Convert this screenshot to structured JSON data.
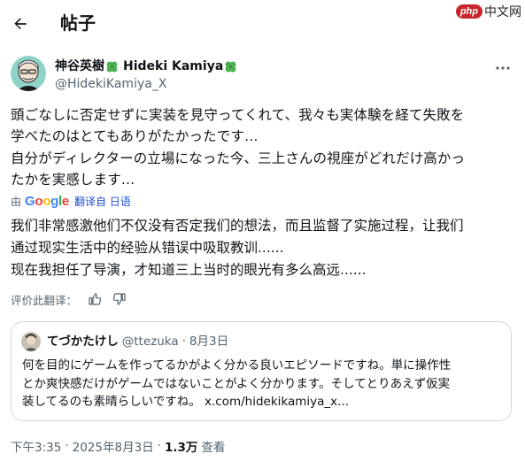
{
  "header": {
    "title": "帖子",
    "watermark_badge": "php",
    "watermark_text": "中文网"
  },
  "author": {
    "name": "神谷英樹",
    "name_en": "Hideki Kamiya",
    "handle": "@HidekiKamiya_X"
  },
  "post": {
    "lines": [
      "頭ごなしに否定せずに実装を見守ってくれて、我々も実体験を経て失敗を",
      "学べたのはとてもありがたかったです…",
      "自分がディレクターの立場になった今、三上さんの視座がどれだけ高かっ",
      "たかを実感します…"
    ]
  },
  "translation": {
    "prefix": "由",
    "provider": "Google",
    "link_label": "翻译自 日语",
    "lines": [
      "我们非常感激他们不仅没有否定我们的想法，而且监督了实施过程，让我们",
      "通过现实生活中的经验从错误中吸取教训......",
      "现在我担任了导演，才知道三上当时的眼光有多么高远......"
    ],
    "rate_label": "评价此翻译："
  },
  "quote": {
    "name": "てづかたけし",
    "handle": "@ttezuka",
    "separator": "·",
    "date": "8月3日",
    "lines": [
      "何を目的にゲームを作ってるかがよく分かる良いエピソードですね。単に操作性",
      "とか爽快感だけがゲームではないことがよく分かります。そしてとりあえず仮実"
    ],
    "line3_text": "装してるのも素晴らしいですね。",
    "link": "x.com/hidekikamiya_x..."
  },
  "meta": {
    "time": "下午3:35",
    "dot1": "·",
    "date": "2025年8月3日",
    "dot2": "·",
    "views": "1.3万",
    "views_label": "查看"
  },
  "colors": {
    "text": "#0f1419",
    "muted": "#536471",
    "border": "#cfd9de",
    "link": "#1d4ed8",
    "clover": "#4caf50",
    "watermark": "#c8262b"
  },
  "icons": {
    "back": "arrow-left-icon",
    "more": "more-horizontal-icon",
    "clover": "four-leaf-clover-icon",
    "thumbs_up": "thumbs-up-icon",
    "thumbs_down": "thumbs-down-icon"
  }
}
